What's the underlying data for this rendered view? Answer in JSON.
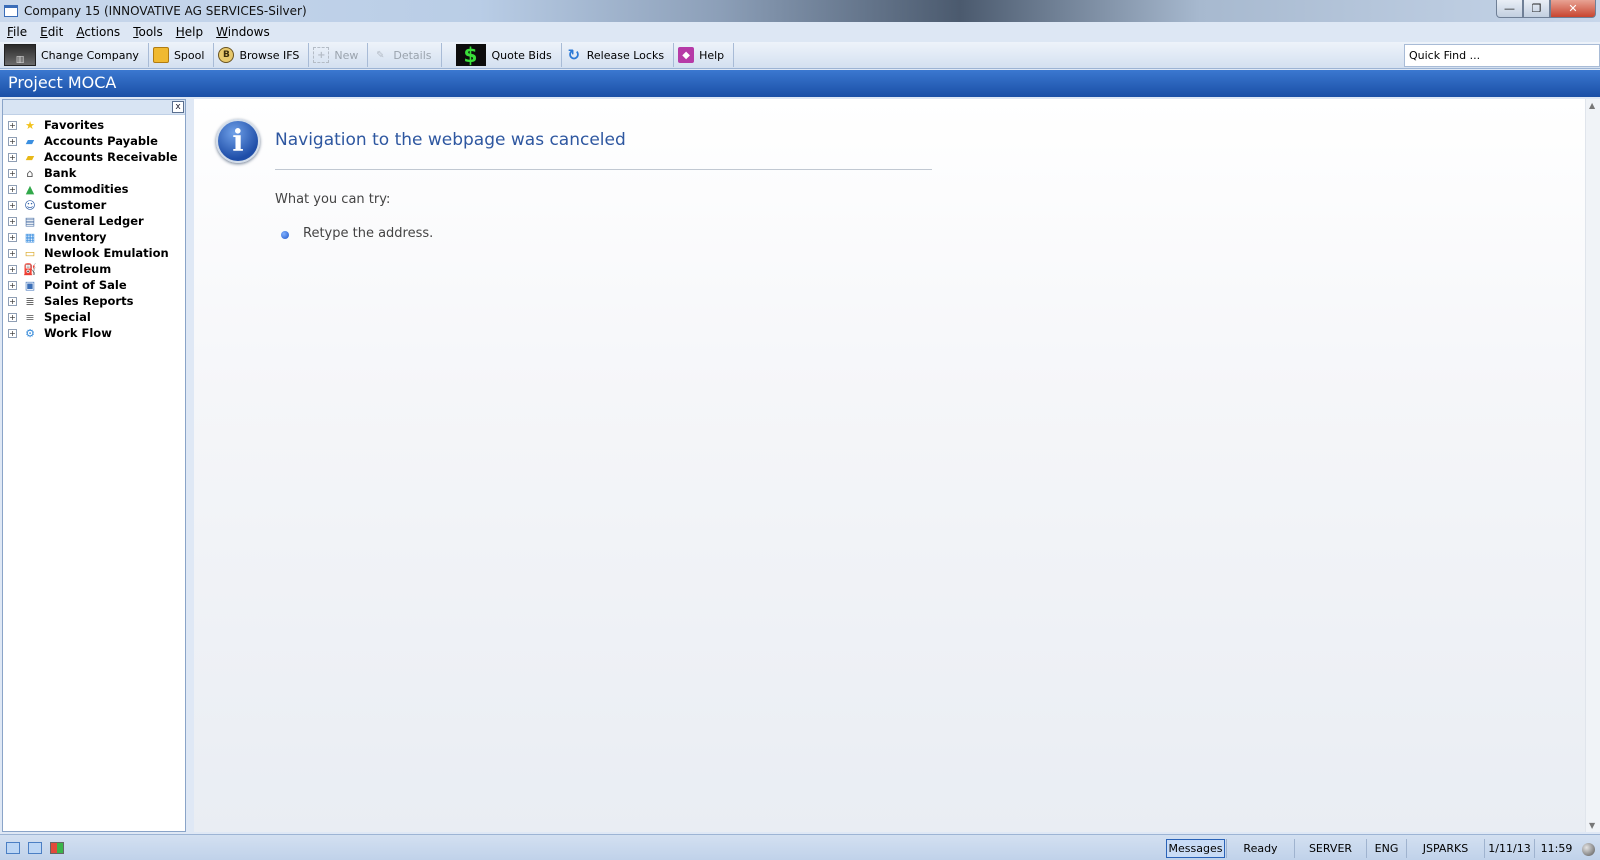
{
  "window": {
    "title": "Company 15 (INNOVATIVE AG SERVICES-Silver)",
    "controls": {
      "minimize": "—",
      "maximize": "❐",
      "close": "✕"
    }
  },
  "menu": [
    {
      "label": "File",
      "mnemonic": "F",
      "rest": "ile"
    },
    {
      "label": "Edit",
      "mnemonic": "E",
      "rest": "dit"
    },
    {
      "label": "Actions",
      "mnemonic": "A",
      "rest": "ctions"
    },
    {
      "label": "Tools",
      "mnemonic": "T",
      "rest": "ools"
    },
    {
      "label": "Help",
      "mnemonic": "H",
      "rest": "elp"
    },
    {
      "label": "Windows",
      "mnemonic": "W",
      "rest": "indows"
    }
  ],
  "toolbar": {
    "change_company": "Change Company",
    "spool": "Spool",
    "browse_ifs": "Browse IFS",
    "browse_ifs_glyph": "B",
    "new": "New",
    "details": "Details",
    "quote_bids": "Quote Bids",
    "quote_bids_glyph": "$",
    "release_locks": "Release Locks",
    "help": "Help",
    "quick_find": "Quick Find ..."
  },
  "banner": {
    "title": "Project MOCA"
  },
  "nav_panel": {
    "close_glyph": "x",
    "expander_glyph": "+",
    "items": [
      {
        "label": "Favorites",
        "icon": "star-icon",
        "glyph": "★",
        "color": "#f2c21b"
      },
      {
        "label": "Accounts Payable",
        "icon": "folder-payable-icon",
        "glyph": "▰",
        "color": "#3b8fe0"
      },
      {
        "label": "Accounts Receivable",
        "icon": "ledger-receivable-icon",
        "glyph": "▰",
        "color": "#e8b818"
      },
      {
        "label": "Bank",
        "icon": "bank-icon",
        "glyph": "⌂",
        "color": "#555555"
      },
      {
        "label": "Commodities",
        "icon": "commodities-icon",
        "glyph": "▲",
        "color": "#31a84a"
      },
      {
        "label": "Customer",
        "icon": "customer-icon",
        "glyph": "☺",
        "color": "#2f5fa8"
      },
      {
        "label": "General Ledger",
        "icon": "ledger-icon",
        "glyph": "▤",
        "color": "#4a6fa5"
      },
      {
        "label": "Inventory",
        "icon": "inventory-icon",
        "glyph": "▦",
        "color": "#3b8fe0"
      },
      {
        "label": "Newlook Emulation",
        "icon": "emulation-icon",
        "glyph": "▭",
        "color": "#d9a520"
      },
      {
        "label": "Petroleum",
        "icon": "petroleum-icon",
        "glyph": "⛽",
        "color": "#333333"
      },
      {
        "label": "Point of Sale",
        "icon": "pos-icon",
        "glyph": "▣",
        "color": "#3b6fb8"
      },
      {
        "label": "Sales Reports",
        "icon": "report-icon",
        "glyph": "≣",
        "color": "#555555"
      },
      {
        "label": "Special",
        "icon": "special-icon",
        "glyph": "≡",
        "color": "#666666"
      },
      {
        "label": "Work Flow",
        "icon": "workflow-gear-icon",
        "glyph": "⚙",
        "color": "#2f86d8"
      }
    ]
  },
  "error_page": {
    "info_glyph": "i",
    "title": "Navigation to the webpage was canceled",
    "try_label": "What you can try:",
    "suggestion": "Retype the address."
  },
  "scrollbar": {
    "up": "▲",
    "down": "▼"
  },
  "status_bar": {
    "messages": "Messages",
    "status": "Ready",
    "server": "SERVER",
    "language": "ENG",
    "user": "JSPARKS",
    "date": "1/11/13",
    "time": "11:59"
  }
}
